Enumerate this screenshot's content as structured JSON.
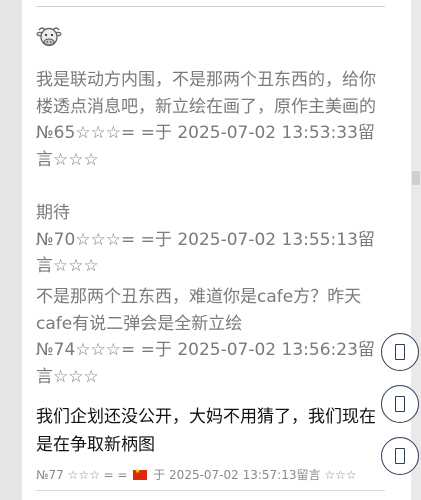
{
  "thread": {
    "quotes": [
      {
        "text": "我是联动方内围，不是那两个丑东西的，给你楼透点消息吧，新立绘在画了，原作主美画的",
        "meta": "№65☆☆☆= =于 2025-07-02 13:53:33留言☆☆☆"
      },
      {
        "text": "期待",
        "meta": "№70☆☆☆= =于 2025-07-02 13:55:13留言☆☆☆"
      },
      {
        "text": "不是那两个丑东西，难道你是cafe方？昨天cafe有说二弹会是全新立绘",
        "meta": "№74☆☆☆= =于 2025-07-02 13:56:23留言☆☆☆"
      }
    ],
    "reply": {
      "text": "我们企划还没公开，大妈不用猜了，我们现在是在争取新柄图",
      "footer_prefix": "№77 ☆☆☆ = =",
      "footer_suffix": "于 2025-07-02 13:57:13留言 ☆☆☆"
    }
  },
  "avatar": {
    "icon": "cow-icon"
  },
  "side_buttons": [
    {
      "icon": "missing-glyph-icon"
    },
    {
      "icon": "missing-glyph-icon"
    },
    {
      "icon": "missing-glyph-icon"
    }
  ],
  "colors": {
    "quote_text": "#7a7a7a",
    "reply_text": "#111111",
    "button_border": "#2c3e57"
  }
}
